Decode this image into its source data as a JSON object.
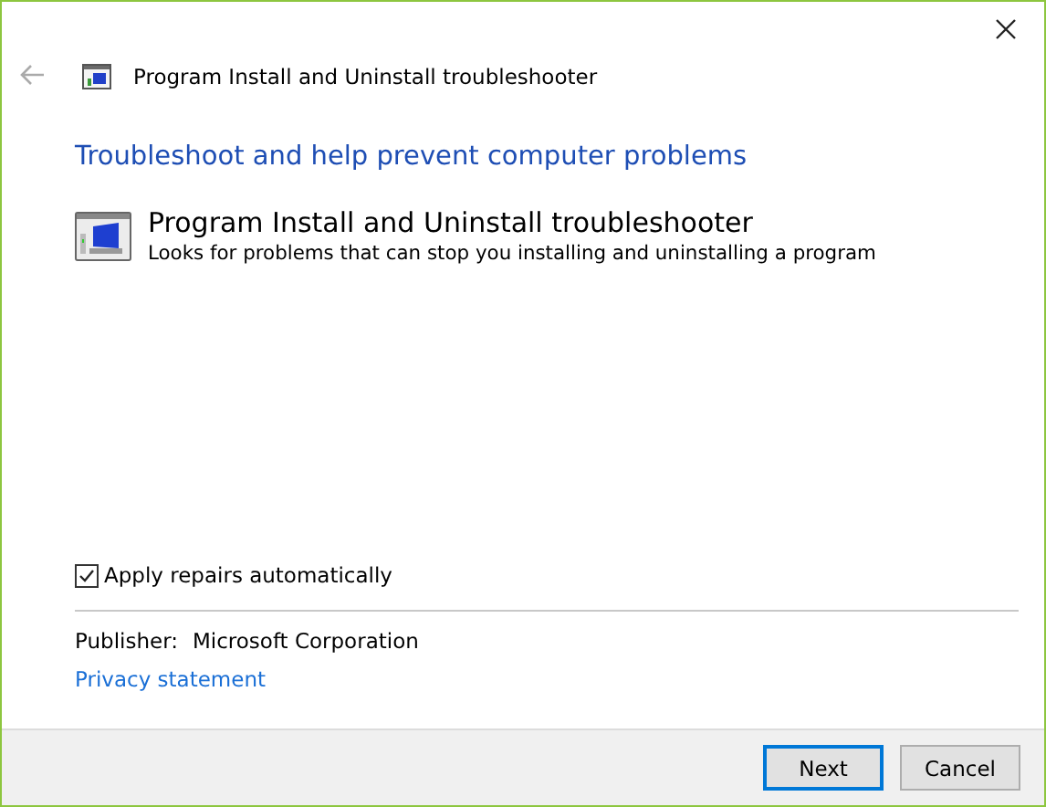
{
  "window": {
    "title": "Program Install and Uninstall troubleshooter"
  },
  "heading": "Troubleshoot and help prevent computer problems",
  "troubleshooter": {
    "title": "Program Install and Uninstall troubleshooter",
    "description": "Looks for problems that can stop you installing and uninstalling a program"
  },
  "apply_repairs": {
    "label": "Apply repairs automatically",
    "checked": true
  },
  "publisher": {
    "label": "Publisher:",
    "value": "Microsoft Corporation"
  },
  "privacy_link": "Privacy statement",
  "buttons": [
    {
      "label": "Next",
      "selected": true
    },
    {
      "label": "Cancel",
      "selected": false
    }
  ]
}
